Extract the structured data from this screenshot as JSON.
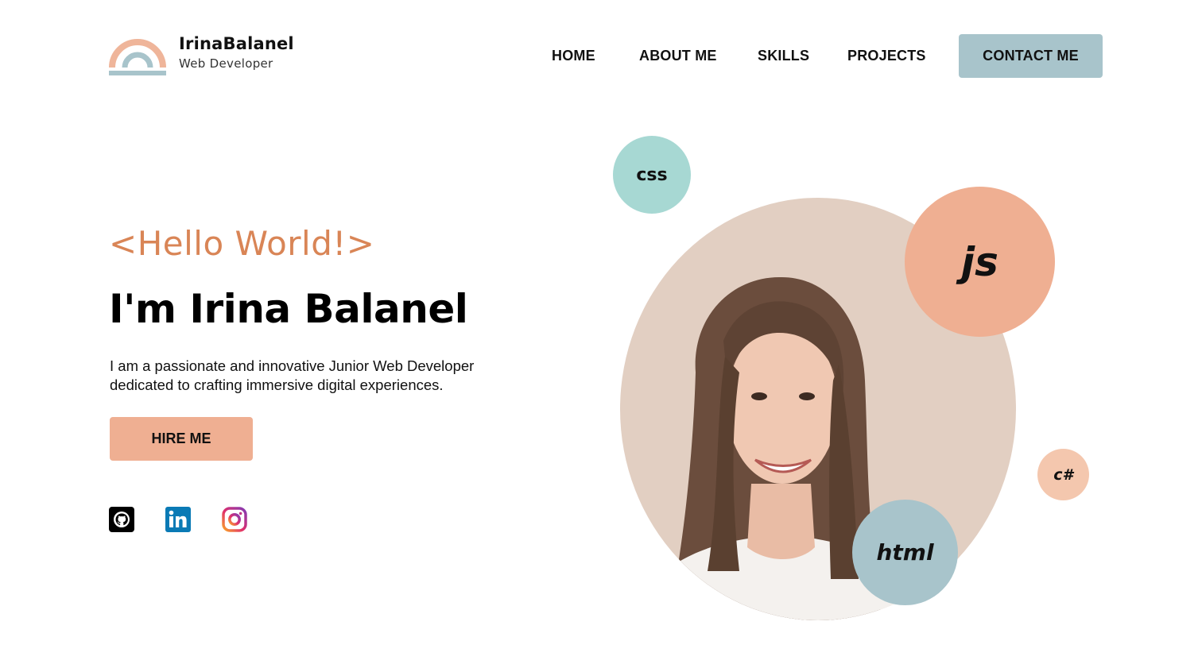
{
  "brand": {
    "name": "IrinaBalanel",
    "role": "Web Developer",
    "logo_icon": "rainbow-arch-logo",
    "colors": {
      "peach": "#efaf92",
      "blue_grey": "#a8c4cb",
      "mint": "#a7d8d3",
      "orange_text": "#d98556"
    }
  },
  "nav": {
    "items": [
      {
        "label": "HOME"
      },
      {
        "label": "ABOUT ME"
      },
      {
        "label": "SKILLS"
      },
      {
        "label": "PROJECTS"
      }
    ],
    "contact_label": "CONTACT ME"
  },
  "hero": {
    "greeting": "<Hello World!>",
    "headline": "I'm Irina Balanel",
    "intro_line1": "I am a passionate and innovative Junior Web Developer",
    "intro_line2": "dedicated to crafting immersive digital experiences.",
    "hire_label": "HIRE ME"
  },
  "social": [
    {
      "icon": "github-icon"
    },
    {
      "icon": "linkedin-icon"
    },
    {
      "icon": "instagram-icon"
    }
  ],
  "skills_bubbles": {
    "css": "css",
    "js": "js",
    "csharp": "c#",
    "html": "html"
  }
}
